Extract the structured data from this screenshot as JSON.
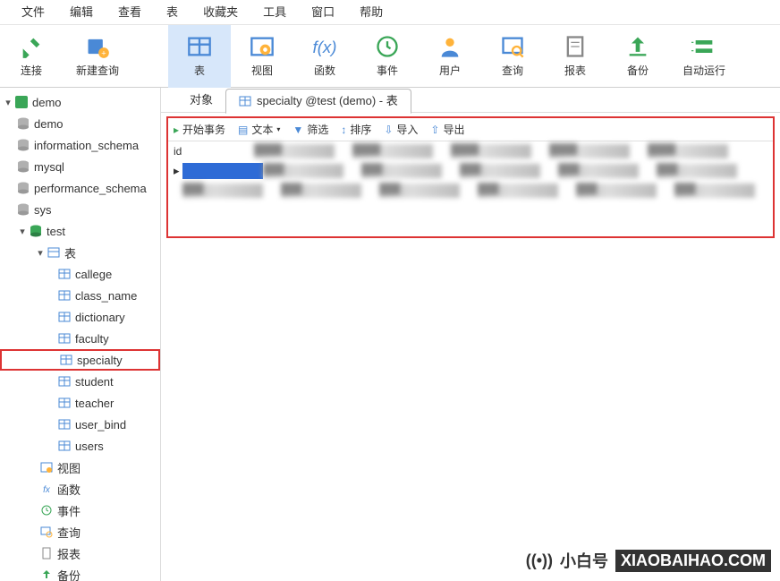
{
  "menu": {
    "file": "文件",
    "edit": "编辑",
    "view": "查看",
    "table": "表",
    "fav": "收藏夹",
    "tool": "工具",
    "window": "窗口",
    "help": "帮助"
  },
  "toolbar": {
    "connect": "连接",
    "newquery": "新建查询",
    "table": "表",
    "view": "视图",
    "function": "函数",
    "event": "事件",
    "user": "用户",
    "query": "查询",
    "report": "报表",
    "backup": "备份",
    "autorun": "自动运行"
  },
  "tree": {
    "root": "demo",
    "dbs": [
      "demo",
      "information_schema",
      "mysql",
      "performance_schema",
      "sys",
      "test"
    ],
    "tables_cat": "表",
    "tables": [
      "callege",
      "class_name",
      "dictionary",
      "faculty",
      "specialty",
      "student",
      "teacher",
      "user_bind",
      "users"
    ],
    "misc": [
      "视图",
      "函数",
      "事件",
      "查询",
      "报表",
      "备份"
    ]
  },
  "tabs": {
    "object": "对象",
    "current": "specialty @test (demo) - 表"
  },
  "actions": {
    "begin": "开始事务",
    "text": "文本",
    "filter": "筛选",
    "sort": "排序",
    "import": "导入",
    "export": "导出"
  },
  "grid": {
    "col0": "id"
  },
  "watermark": {
    "a": "小白号",
    "b": "XIAOBAIHAO.COM"
  }
}
